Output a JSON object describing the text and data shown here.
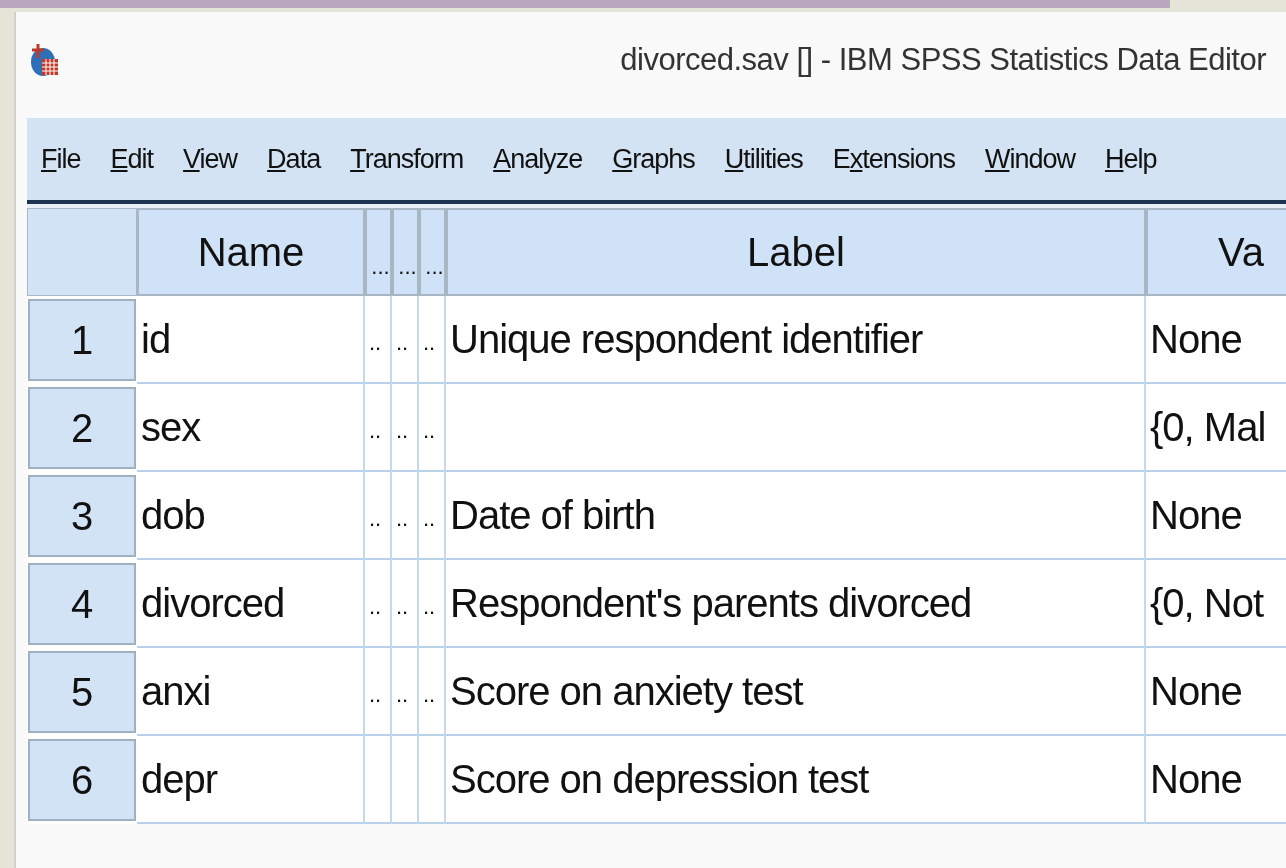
{
  "window": {
    "title": "divorced.sav [] - IBM SPSS Statistics Data Editor"
  },
  "menu": [
    {
      "key": "F",
      "rest": "ile"
    },
    {
      "key": "E",
      "rest": "dit"
    },
    {
      "key": "V",
      "rest": "iew"
    },
    {
      "key": "D",
      "rest": "ata"
    },
    {
      "key": "T",
      "rest": "ransform"
    },
    {
      "key": "A",
      "rest": "nalyze"
    },
    {
      "key": "G",
      "rest": "raphs"
    },
    {
      "key": "U",
      "rest": "tilities"
    },
    {
      "lead": "E",
      "key": "x",
      "rest": "tensions"
    },
    {
      "key": "W",
      "rest": "indow"
    },
    {
      "key": "H",
      "rest": "elp"
    }
  ],
  "table": {
    "columns": [
      "Name",
      "...",
      "...",
      "...",
      "Label",
      "Va"
    ],
    "rows": [
      {
        "number": "1",
        "name": "id",
        "dots": [
          "..",
          "..",
          ".."
        ],
        "label": "Unique respondent identifier",
        "values": "None"
      },
      {
        "number": "2",
        "name": "sex",
        "dots": [
          "..",
          "..",
          ".."
        ],
        "values": "{0, Mal"
      },
      {
        "number": "3",
        "name": "dob",
        "dots": [
          "..",
          "..",
          ".."
        ],
        "label": "Date of birth",
        "values": "None"
      },
      {
        "number": "4",
        "name": "divorced",
        "dots": [
          "..",
          "..",
          ".."
        ],
        "label": "Respondent's parents divorced",
        "values": "{0, Not"
      },
      {
        "number": "5",
        "name": "anxi",
        "dots": [
          "..",
          "..",
          ".."
        ],
        "label": "Score on anxiety test",
        "values": "None"
      },
      {
        "number": "6",
        "name": "depr",
        "label": "Score on depression test",
        "values": "None"
      }
    ]
  }
}
